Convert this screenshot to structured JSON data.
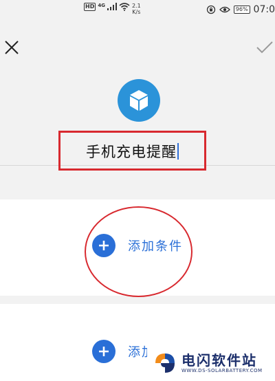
{
  "status_bar": {
    "hd": "HD",
    "network": "4G",
    "speed_value": "2.1",
    "speed_unit": "K/s",
    "battery": "96%",
    "time": "07:0"
  },
  "header": {
    "close_icon": "close-icon",
    "confirm_icon": "checkmark-icon"
  },
  "task": {
    "icon": "cube-icon",
    "icon_color": "#2b93d9",
    "name": "手机充电提醒"
  },
  "condition": {
    "add_label": "添加条件"
  },
  "action": {
    "add_label": "添加操作"
  },
  "watermark": {
    "title": "电闪软件站",
    "url": "WWW.DS-SOLARBATTERY.COM"
  },
  "colors": {
    "accent": "#2a6fd7",
    "annotation": "#d8292f"
  }
}
